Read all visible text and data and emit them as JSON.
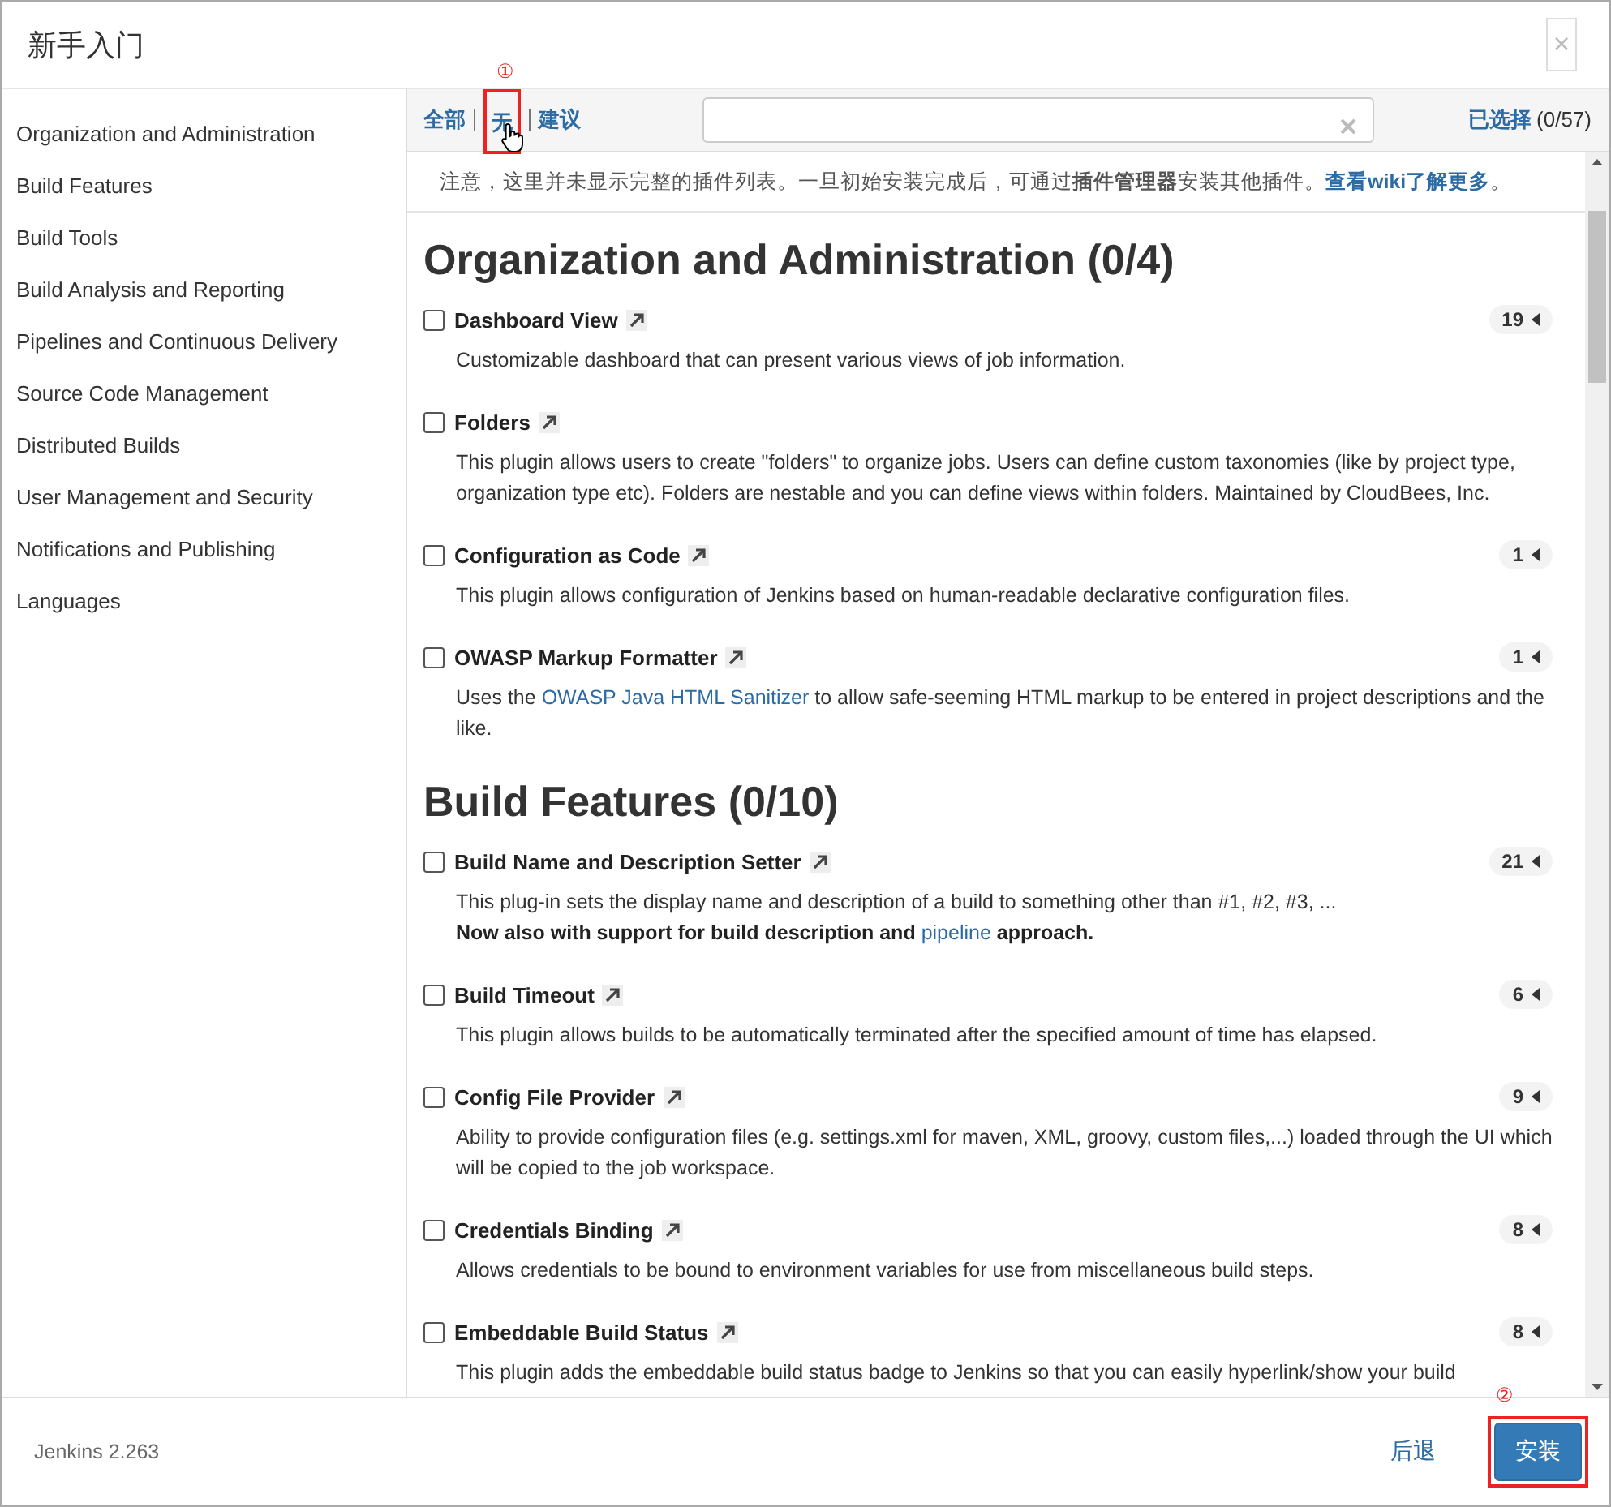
{
  "window": {
    "title": "新手入门",
    "close": "×"
  },
  "sidebar": {
    "items": [
      {
        "label": "Organization and Administration",
        "selected": false
      },
      {
        "label": "Build Features",
        "selected": false
      },
      {
        "label": "Build Tools",
        "selected": false
      },
      {
        "label": "Build Analysis and Reporting",
        "selected": false
      },
      {
        "label": "Pipelines and Continuous Delivery",
        "selected": false
      },
      {
        "label": "Source Code Management",
        "selected": false
      },
      {
        "label": "Distributed Builds",
        "selected": false
      },
      {
        "label": "User Management and Security",
        "selected": false
      },
      {
        "label": "Notifications and Publishing",
        "selected": false
      },
      {
        "label": "Languages",
        "selected": false
      }
    ]
  },
  "toolbar": {
    "filters": [
      {
        "label": "全部"
      },
      {
        "label": "无",
        "annotation": "①"
      },
      {
        "label": "建议"
      }
    ],
    "selected_link": "已选择",
    "selected_count": "(0/57)"
  },
  "notice": [
    {
      "kind": "text",
      "text": "注意，这里并未显示完整的插件列表。一旦初始安装完成后，可通过"
    },
    {
      "kind": "bold",
      "text": "插件管理器"
    },
    {
      "kind": "text",
      "text": "安装其他插件。"
    },
    {
      "kind": "link",
      "text": "查看wiki了解更多"
    },
    {
      "kind": "text",
      "text": "。"
    }
  ],
  "sections": [
    {
      "title": "Organization and Administration (0/4)",
      "plugins": [
        {
          "name": "Dashboard View",
          "checked": false,
          "count": "19",
          "description": [
            [
              {
                "kind": "text",
                "text": "Customizable dashboard that can present various views of job information."
              }
            ]
          ]
        },
        {
          "name": "Folders",
          "checked": false,
          "description": [
            [
              {
                "kind": "text",
                "text": "This plugin allows users to create \"folders\" to organize jobs. Users can define custom taxonomies (like by project type, organization type etc). Folders are nestable and you can define views within folders. Maintained by CloudBees, Inc."
              }
            ]
          ]
        },
        {
          "name": "Configuration as Code",
          "checked": false,
          "count": "1",
          "description": [
            [
              {
                "kind": "text",
                "text": "This plugin allows configuration of Jenkins based on human-readable declarative configuration files."
              }
            ]
          ]
        },
        {
          "name": "OWASP Markup Formatter",
          "checked": false,
          "count": "1",
          "description": [
            [
              {
                "kind": "text",
                "text": "Uses the "
              },
              {
                "kind": "link",
                "text": "OWASP Java HTML Sanitizer"
              },
              {
                "kind": "text",
                "text": " to allow safe-seeming HTML markup to be entered in project descriptions and the like."
              }
            ]
          ]
        }
      ]
    },
    {
      "title": "Build Features (0/10)",
      "plugins": [
        {
          "name": "Build Name and Description Setter",
          "checked": false,
          "count": "21",
          "description": [
            [
              {
                "kind": "text",
                "text": "This plug-in sets the display name and description of a build to something other than #1, #2, #3, ..."
              }
            ],
            [
              {
                "kind": "bold",
                "text": "Now also with support for build description and "
              },
              {
                "kind": "link",
                "text": "pipeline"
              },
              {
                "kind": "bold",
                "text": " approach."
              }
            ]
          ]
        },
        {
          "name": "Build Timeout",
          "checked": false,
          "count": "6",
          "description": [
            [
              {
                "kind": "text",
                "text": "This plugin allows builds to be automatically terminated after the specified amount of time has elapsed."
              }
            ]
          ]
        },
        {
          "name": "Config File Provider",
          "checked": false,
          "count": "9",
          "description": [
            [
              {
                "kind": "text",
                "text": "Ability to provide configuration files (e.g. settings.xml for maven, XML, groovy, custom files,...) loaded through the UI which will be copied to the job workspace."
              }
            ]
          ]
        },
        {
          "name": "Credentials Binding",
          "checked": false,
          "count": "8",
          "description": [
            [
              {
                "kind": "text",
                "text": "Allows credentials to be bound to environment variables for use from miscellaneous build steps."
              }
            ]
          ]
        },
        {
          "name": "Embeddable Build Status",
          "checked": false,
          "count": "8",
          "description": [
            [
              {
                "kind": "text",
                "text": "This plugin adds the embeddable build status badge to Jenkins so that you can easily hyperlink/show your build"
              }
            ]
          ]
        }
      ]
    }
  ],
  "footer": {
    "version": "Jenkins 2.263",
    "back": "后退",
    "install": "安装",
    "install_annotation": "②"
  }
}
